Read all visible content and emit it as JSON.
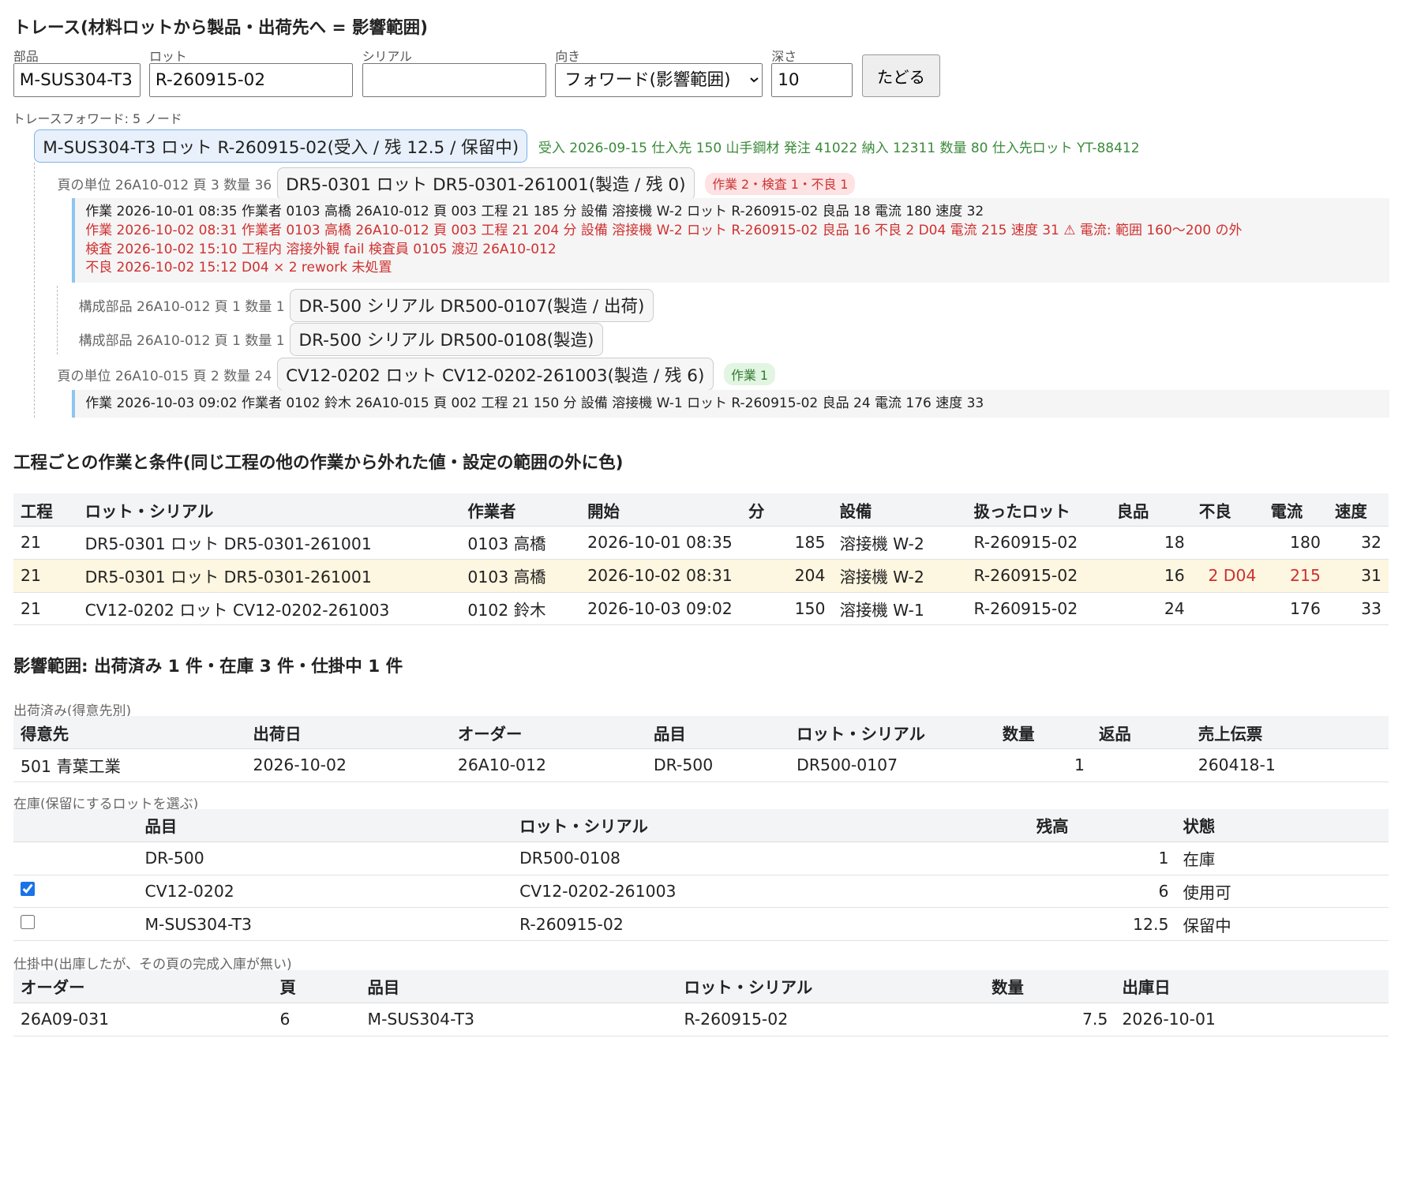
{
  "title": "トレース(材料ロットから製品・出荷先へ = 影響範囲)",
  "form": {
    "part_label": "部品",
    "part_value": "M-SUS304-T3",
    "lot_label": "ロット",
    "lot_value": "R-260915-02",
    "serial_label": "シリアル",
    "serial_value": "",
    "direction_label": "向き",
    "direction_value": "フォワード(影響範囲)",
    "depth_label": "深さ",
    "depth_value": "10",
    "trace_button": "たどる"
  },
  "trace": {
    "caption": "トレースフォワード: 5 ノード",
    "root_node": "M-SUS304-T3 ロット R-260915-02(受入 / 残 12.5 / 保留中)",
    "root_receipt": "受入 2026-09-15 仕入先 150 山手鋼材 発注 41022 納入 12311 数量 80 仕入先ロット YT-88412",
    "node1_label": "頁の単位 26A10-012 頁 3 数量 36",
    "node1": "DR5-0301 ロット DR5-0301-261001(製造 / 残 0)",
    "node1_badge": "作業 2・検査 1・不良 1",
    "node1_log": [
      {
        "text": "作業 2026-10-01 08:35 作業者 0103 高橋 26A10-012 頁 003 工程 21 185 分 設備 溶接機 W-2 ロット R-260915-02 良品 18 電流 180 速度 32",
        "warn": false
      },
      {
        "text": "作業 2026-10-02 08:31 作業者 0103 高橋 26A10-012 頁 003 工程 21 204 分 設備 溶接機 W-2 ロット R-260915-02 良品 16 不良 2 D04 電流 215 速度 31 ⚠ 電流: 範囲 160〜200 の外",
        "warn": true
      },
      {
        "text": "検査 2026-10-02 15:10 工程内 溶接外観 fail 検査員 0105 渡辺 26A10-012",
        "warn": true
      },
      {
        "text": "不良 2026-10-02 15:12 D04 × 2 rework 未処置",
        "warn": true
      }
    ],
    "child1_label": "構成部品 26A10-012 頁 1 数量 1",
    "child1": "DR-500 シリアル DR500-0107(製造 / 出荷)",
    "child2_label": "構成部品 26A10-012 頁 1 数量 1",
    "child2": "DR-500 シリアル DR500-0108(製造)",
    "node2_label": "頁の単位 26A10-015 頁 2 数量 24",
    "node2": "CV12-0202 ロット CV12-0202-261003(製造 / 残 6)",
    "node2_badge": "作業 1",
    "node2_log": [
      {
        "text": "作業 2026-10-03 09:02 作業者 0102 鈴木 26A10-015 頁 002 工程 21 150 分 設備 溶接機 W-1 ロット R-260915-02 良品 24 電流 176 速度 33",
        "warn": false
      }
    ]
  },
  "process": {
    "heading": "工程ごとの作業と条件(同じ工程の他の作業から外れた値・設定の範囲の外に色)",
    "columns": [
      "工程",
      "ロット・シリアル",
      "作業者",
      "開始",
      "分",
      "設備",
      "扱ったロット",
      "良品",
      "不良",
      "電流",
      "速度"
    ],
    "rows": [
      {
        "proc": "21",
        "lot": "DR5-0301 ロット DR5-0301-261001",
        "worker": "0103 高橋",
        "start": "2026-10-01 08:35",
        "min": "185",
        "equip": "溶接機 W-2",
        "used": "R-260915-02",
        "good": "18",
        "bad": "",
        "current": "180",
        "speed": "32",
        "hl": false
      },
      {
        "proc": "21",
        "lot": "DR5-0301 ロット DR5-0301-261001",
        "worker": "0103 高橋",
        "start": "2026-10-02 08:31",
        "min": "204",
        "equip": "溶接機 W-2",
        "used": "R-260915-02",
        "good": "16",
        "bad": "2 D04",
        "current": "215",
        "speed": "31",
        "hl": true
      },
      {
        "proc": "21",
        "lot": "CV12-0202 ロット CV12-0202-261003",
        "worker": "0102 鈴木",
        "start": "2026-10-03 09:02",
        "min": "150",
        "equip": "溶接機 W-1",
        "used": "R-260915-02",
        "good": "24",
        "bad": "",
        "current": "176",
        "speed": "33",
        "hl": false
      }
    ]
  },
  "impact": {
    "heading": "影響範囲: 出荷済み 1 件・在庫 3 件・仕掛中 1 件",
    "shipped_caption": "出荷済み(得意先別)",
    "shipped_columns": [
      "得意先",
      "出荷日",
      "オーダー",
      "品目",
      "ロット・シリアル",
      "数量",
      "返品",
      "売上伝票"
    ],
    "shipped_rows": [
      {
        "customer": "501 青葉工業",
        "date": "2026-10-02",
        "order": "26A10-012",
        "item": "DR-500",
        "lot": "DR500-0107",
        "qty": "1",
        "ret": "",
        "slip": "260418-1"
      }
    ],
    "stock_caption": "在庫(保留にするロットを選ぶ)",
    "stock_columns": [
      "",
      "品目",
      "ロット・シリアル",
      "残高",
      "状態"
    ],
    "stock_rows": [
      {
        "check": "none",
        "item": "DR-500",
        "lot": "DR500-0108",
        "bal": "1",
        "state": "在庫"
      },
      {
        "check": "checked",
        "item": "CV12-0202",
        "lot": "CV12-0202-261003",
        "bal": "6",
        "state": "使用可"
      },
      {
        "check": "unchecked",
        "item": "M-SUS304-T3",
        "lot": "R-260915-02",
        "bal": "12.5",
        "state": "保留中"
      }
    ],
    "wip_caption": "仕掛中(出庫したが、その頁の完成入庫が無い)",
    "wip_columns": [
      "オーダー",
      "頁",
      "品目",
      "ロット・シリアル",
      "数量",
      "出庫日"
    ],
    "wip_rows": [
      {
        "order": "26A09-031",
        "page": "6",
        "item": "M-SUS304-T3",
        "lot": "R-260915-02",
        "qty": "7.5",
        "date": "2026-10-01"
      }
    ]
  }
}
